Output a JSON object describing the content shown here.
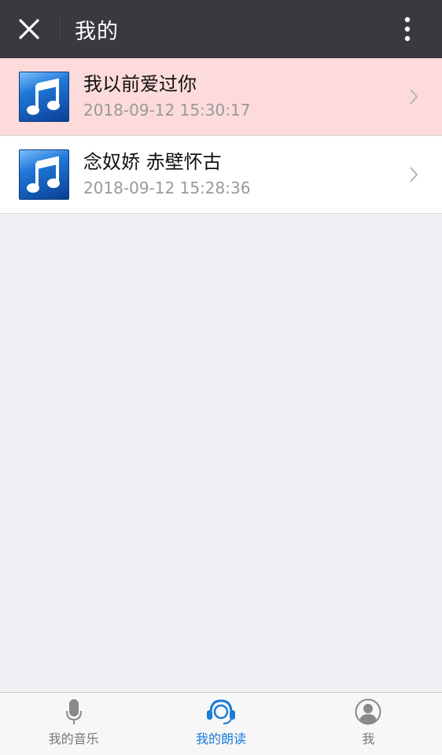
{
  "header": {
    "title": "我的"
  },
  "items": [
    {
      "title": "我以前爱过你",
      "date": "2018-09-12 15:30:17"
    },
    {
      "title": "念奴娇 赤壁怀古",
      "date": "2018-09-12 15:28:36"
    }
  ],
  "tabs": [
    {
      "label": "我的音乐"
    },
    {
      "label": "我的朗读"
    },
    {
      "label": "我"
    }
  ],
  "colors": {
    "header_bg": "#393a3f",
    "active_row_bg": "#fddbdb",
    "active_tab": "#1a7bd8"
  }
}
